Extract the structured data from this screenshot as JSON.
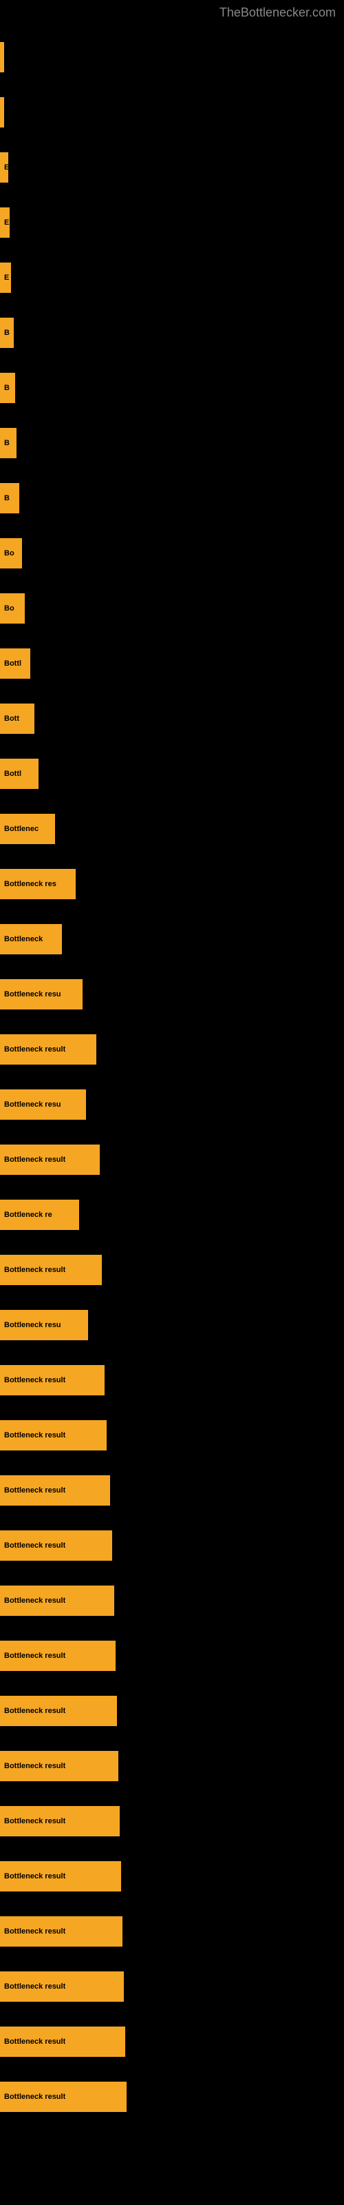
{
  "site": {
    "title": "TheBottlenecker.com"
  },
  "bars": [
    {
      "id": 1,
      "label": "",
      "width": 4
    },
    {
      "id": 2,
      "label": "",
      "width": 4
    },
    {
      "id": 3,
      "label": "E",
      "width": 12
    },
    {
      "id": 4,
      "label": "E",
      "width": 14
    },
    {
      "id": 5,
      "label": "E",
      "width": 16
    },
    {
      "id": 6,
      "label": "B",
      "width": 20
    },
    {
      "id": 7,
      "label": "B",
      "width": 22
    },
    {
      "id": 8,
      "label": "B",
      "width": 24
    },
    {
      "id": 9,
      "label": "B",
      "width": 28
    },
    {
      "id": 10,
      "label": "Bo",
      "width": 32
    },
    {
      "id": 11,
      "label": "Bo",
      "width": 36
    },
    {
      "id": 12,
      "label": "Bottl",
      "width": 44
    },
    {
      "id": 13,
      "label": "Bott",
      "width": 50
    },
    {
      "id": 14,
      "label": "Bottl",
      "width": 56
    },
    {
      "id": 15,
      "label": "Bottlenec",
      "width": 80
    },
    {
      "id": 16,
      "label": "Bottleneck res",
      "width": 110
    },
    {
      "id": 17,
      "label": "Bottleneck",
      "width": 90
    },
    {
      "id": 18,
      "label": "Bottleneck resu",
      "width": 120
    },
    {
      "id": 19,
      "label": "Bottleneck result",
      "width": 140
    },
    {
      "id": 20,
      "label": "Bottleneck resu",
      "width": 125
    },
    {
      "id": 21,
      "label": "Bottleneck result",
      "width": 145
    },
    {
      "id": 22,
      "label": "Bottleneck re",
      "width": 115
    },
    {
      "id": 23,
      "label": "Bottleneck result",
      "width": 148
    },
    {
      "id": 24,
      "label": "Bottleneck resu",
      "width": 128
    },
    {
      "id": 25,
      "label": "Bottleneck result",
      "width": 152
    },
    {
      "id": 26,
      "label": "Bottleneck result",
      "width": 155
    },
    {
      "id": 27,
      "label": "Bottleneck result",
      "width": 160
    },
    {
      "id": 28,
      "label": "Bottleneck result",
      "width": 163
    },
    {
      "id": 29,
      "label": "Bottleneck result",
      "width": 166
    },
    {
      "id": 30,
      "label": "Bottleneck result",
      "width": 168
    },
    {
      "id": 31,
      "label": "Bottleneck result",
      "width": 170
    },
    {
      "id": 32,
      "label": "Bottleneck result",
      "width": 172
    },
    {
      "id": 33,
      "label": "Bottleneck result",
      "width": 174
    },
    {
      "id": 34,
      "label": "Bottleneck result",
      "width": 176
    },
    {
      "id": 35,
      "label": "Bottleneck result",
      "width": 178
    },
    {
      "id": 36,
      "label": "Bottleneck result",
      "width": 180
    },
    {
      "id": 37,
      "label": "Bottleneck result",
      "width": 182
    },
    {
      "id": 38,
      "label": "Bottleneck result",
      "width": 184
    }
  ]
}
